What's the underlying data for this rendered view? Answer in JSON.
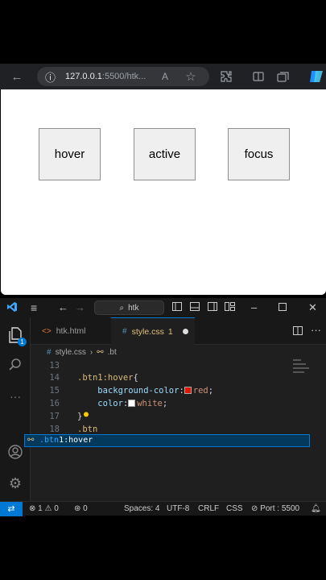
{
  "browser": {
    "url_host": "127.0.0.1",
    "url_rest": ":5500/htk...",
    "back_icon": "←",
    "info_icon": "ⓘ",
    "read_aloud_icon": "A",
    "favorite_icon": "☆"
  },
  "page": {
    "buttons": [
      "hover",
      "active",
      "focus"
    ]
  },
  "vscode": {
    "search": "htk",
    "tabs": [
      {
        "label": "htk.html",
        "icon": "<>"
      },
      {
        "label": "style.css",
        "icon": "#",
        "problems": "1"
      }
    ],
    "breadcrumb": {
      "file": "style.css",
      "symbol": ".bt"
    },
    "explorer_badge": "1",
    "lines": [
      {
        "n": "13",
        "code": ""
      },
      {
        "n": "14",
        "selector": ".btn1:hover",
        "brace": "{"
      },
      {
        "n": "15",
        "prop": "background-color",
        "value": "red",
        "swatch": "#e51400"
      },
      {
        "n": "16",
        "prop": "color",
        "value": "white",
        "swatch": "#ffffff"
      },
      {
        "n": "17",
        "code": "}"
      },
      {
        "n": "18",
        "code": ".btn"
      }
    ],
    "suggestion": {
      "match": ".btn",
      "rest": "1:hover"
    },
    "status": {
      "errors": "1",
      "warnings": "0",
      "ports": "0",
      "spaces": "Spaces: 4",
      "encoding": "UTF-8",
      "eol": "CRLF",
      "language": "CSS",
      "port": "Port : 5500"
    }
  }
}
